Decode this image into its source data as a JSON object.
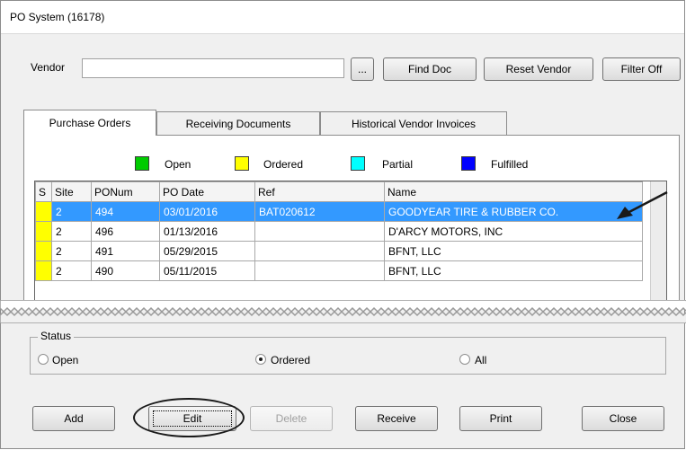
{
  "window": {
    "title": "PO System (16178)"
  },
  "vendor": {
    "label": "Vendor",
    "value": "",
    "browse_label": "...",
    "find_doc_label": "Find Doc",
    "reset_vendor_label": "Reset Vendor",
    "filter_label": "Filter Off"
  },
  "tabs": [
    {
      "label": "Purchase Orders",
      "active": true
    },
    {
      "label": "Receiving Documents",
      "active": false
    },
    {
      "label": "Historical Vendor Invoices",
      "active": false
    }
  ],
  "legend": [
    {
      "label": "Open",
      "color": "#00cc00"
    },
    {
      "label": "Ordered",
      "color": "#ffff00"
    },
    {
      "label": "Partial",
      "color": "#00ffff"
    },
    {
      "label": "Fulfilled",
      "color": "#0000ff"
    }
  ],
  "grid": {
    "columns": [
      "S",
      "Site",
      "PONum",
      "PO Date",
      "Ref",
      "Name"
    ],
    "rows": [
      {
        "status_color": "#ffff00",
        "site": "2",
        "ponum": "494",
        "po_date": "03/01/2016",
        "ref": "BAT020612",
        "name": "GOODYEAR TIRE & RUBBER CO.",
        "selected": true
      },
      {
        "status_color": "#ffff00",
        "site": "2",
        "ponum": "496",
        "po_date": "01/13/2016",
        "ref": "",
        "name": "D'ARCY MOTORS, INC",
        "selected": false
      },
      {
        "status_color": "#ffff00",
        "site": "2",
        "ponum": "491",
        "po_date": "05/29/2015",
        "ref": "",
        "name": "BFNT, LLC",
        "selected": false
      },
      {
        "status_color": "#ffff00",
        "site": "2",
        "ponum": "490",
        "po_date": "05/11/2015",
        "ref": "",
        "name": "BFNT, LLC",
        "selected": false
      }
    ]
  },
  "status": {
    "label": "Status",
    "options": [
      {
        "label": "Open",
        "checked": false
      },
      {
        "label": "Ordered",
        "checked": true
      },
      {
        "label": "All",
        "checked": false
      }
    ]
  },
  "actions": {
    "add": "Add",
    "edit": "Edit",
    "delete": "Delete",
    "receive": "Receive",
    "print": "Print",
    "close": "Close"
  }
}
